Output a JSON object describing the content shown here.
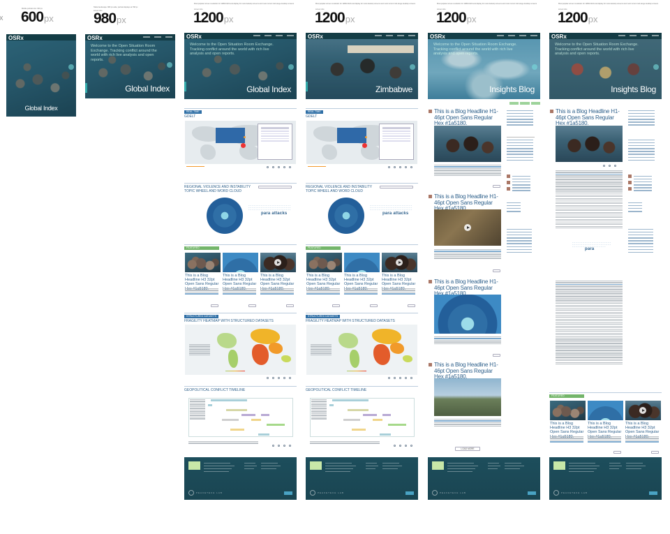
{
  "page": {
    "cut_label": "x",
    "size_600_caption": "Mobile portrait size: 600 px",
    "size_980_caption": "Tablet landscape: 980 px wide; portrait displays at 768 px",
    "size_1200_caption": "Most popular screen resolution for 1280x1024 and display for most desktop screens and most current mid-range desktop screens",
    "size_sub_caption": "screen size"
  },
  "columns": [
    {
      "id": "mobile",
      "width_num": "600",
      "width_unit": "px",
      "hero_title": "Global Index",
      "logo": "OSRx"
    },
    {
      "id": "tablet",
      "width_num": "980",
      "width_unit": "px",
      "hero_title": "Global Index",
      "logo": "OSRx"
    },
    {
      "id": "desktop-global",
      "width_num": "1200",
      "width_unit": "px",
      "hero_title": "Global Index",
      "logo": "OSRx"
    },
    {
      "id": "desktop-zimbabwe",
      "width_num": "1200",
      "width_unit": "px",
      "hero_title": "Zimbabwe",
      "logo": "OSRx"
    },
    {
      "id": "desktop-blog-list",
      "width_num": "1200",
      "width_unit": "px",
      "hero_title": "Insights Blog",
      "logo": "OSRx"
    },
    {
      "id": "desktop-blog-post",
      "width_num": "1200",
      "width_unit": "px",
      "hero_title": "Insights Blog",
      "logo": "OSRx"
    }
  ],
  "hero": {
    "intro": "Welcome to the Open Situation Room Exchange. Tracking conflict around the world with rich live analysis and open reports."
  },
  "sections": {
    "realtime_tag": "REAL-TIME",
    "geo_title": "GDELT",
    "regional_title_1": "REGIONAL VIOLENCE AND INSTABILITY",
    "regional_title_2": "TOPIC WHEEL AND WORD CLOUD",
    "featured_tag": "FEATURED",
    "structured_tag": "STRUCTURED DATASETS",
    "heatmap_title": "FRAGILITY HEATMAP WITH STRUCTURED DATASETS",
    "timeline_title": "GEOPOLITICAL CONFLICT TIMELINE",
    "cloud_word": "para attacks",
    "cloud_word_blog": "para"
  },
  "featured": {
    "card_headlines": [
      "This is a Blog Headline H3 32pt Open Sans Regular Hex #1a5180.",
      "This is a Blog Headline H3 32pt Open Sans Regular Hex #1a5180.",
      "This is a Blog Headline H3 32pt Open Sans Regular Hex #1a5180."
    ],
    "card_headlines_zimbabwe": [
      "This is a Blog Headline H3 32pt Open Sans Regular Hex #1a5180.",
      "This is a Blog Headline H3 32pt Open Sans Regular Hex #1a5180.",
      "This is a Blog Headline H3 32pt Open Sans Regular Hex #1a5180."
    ],
    "card_headlines_post": [
      "This is a Blog Headline H3 32pt Open Sans Regular Hex #1a5180.",
      "This is a Blog Headline H3 32pt Open Sans Regular Hex #1a5180.",
      "This is a Blog Headline H3 32pt Open Sans Regular Hex #1a5180."
    ]
  },
  "blog": {
    "headline": "This is a Blog Headline H1-46pt Open Sans Regular Hex #1a5180.",
    "load_more": "LOAD MORE"
  },
  "footer": {
    "brand": "PEACETECH LAB"
  },
  "colors": {
    "accent_blue": "#2d5f8a",
    "header_teal": "#123a42",
    "footer_teal": "#1d4e5c",
    "green_tag": "#73b56a"
  }
}
